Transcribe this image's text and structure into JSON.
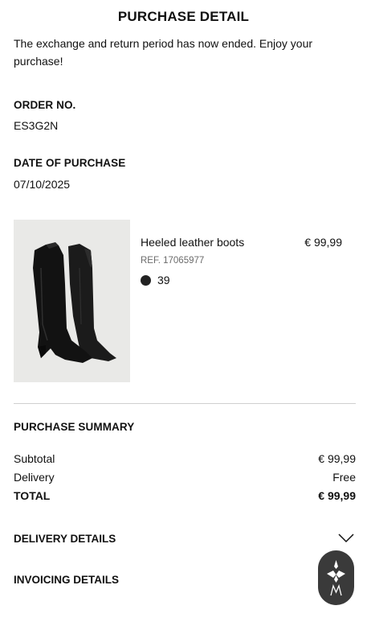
{
  "header": {
    "title": "PURCHASE DETAIL"
  },
  "notice": "The exchange and return period has now ended. Enjoy your purchase!",
  "order": {
    "number_label": "ORDER NO.",
    "number_value": "ES3G2N",
    "date_label": "DATE OF PURCHASE",
    "date_value": "07/10/2025"
  },
  "product": {
    "name": "Heeled leather boots",
    "price": "€ 99,99",
    "ref": "REF. 17065977",
    "color": "#222222",
    "size": "39",
    "image_icon": "black-leather-boots-image"
  },
  "summary": {
    "title": "PURCHASE SUMMARY",
    "subtotal_label": "Subtotal",
    "subtotal_value": "€ 99,99",
    "delivery_label": "Delivery",
    "delivery_value": "Free",
    "total_label": "TOTAL",
    "total_value": "€ 99,99"
  },
  "sections": {
    "delivery_label": "DELIVERY DETAILS",
    "delivery_icon": "chevron-down-icon",
    "invoicing_label": "INVOICING DETAILS"
  },
  "assistant": {
    "icon": "brand-logo-icon",
    "color": "#3a3a3a"
  }
}
